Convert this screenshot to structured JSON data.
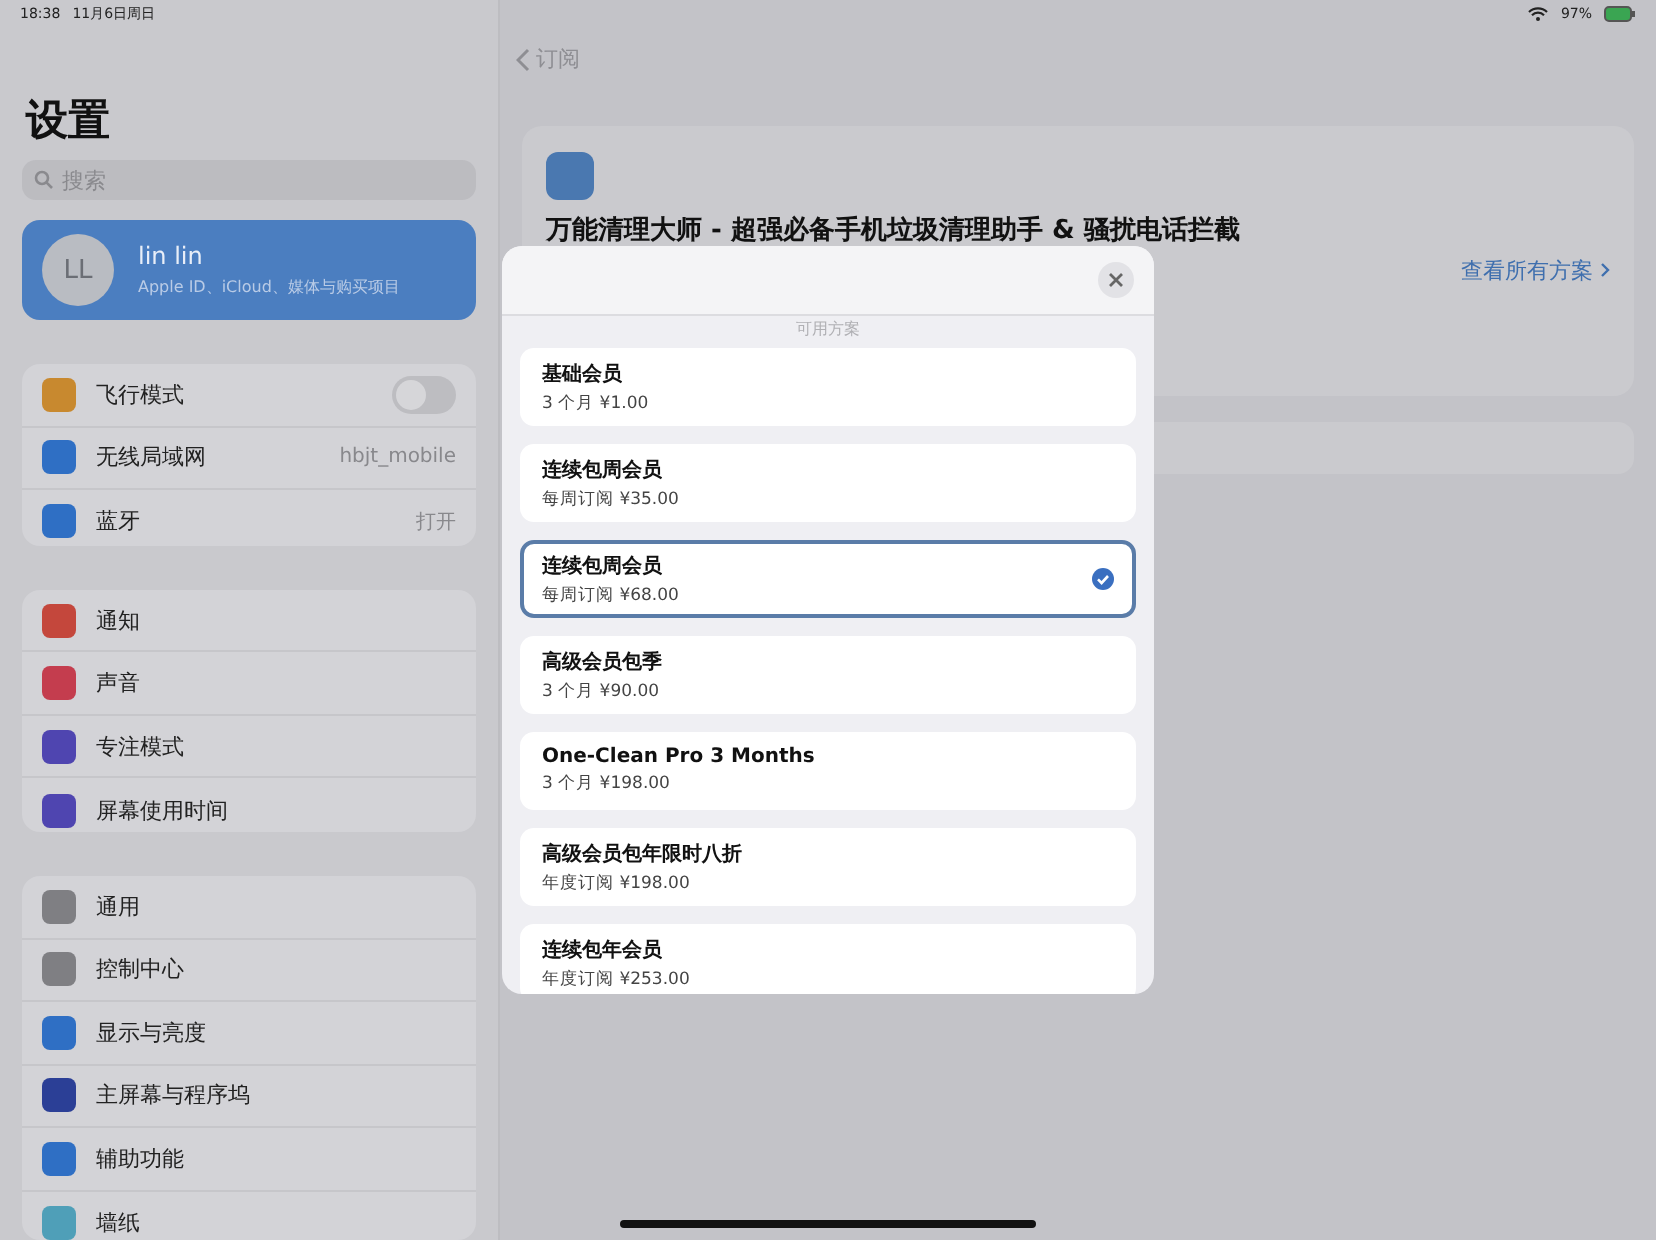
{
  "status_bar": {
    "time": "18:38",
    "date": "11月6日周日",
    "battery": "97%"
  },
  "sidebar": {
    "title": "设置",
    "search": {
      "placeholder": "搜索"
    },
    "profile": {
      "initials": "LL",
      "name": "lin lin",
      "subtitle": "Apple ID、iCloud、媒体与购买项目"
    },
    "groups": [
      [
        {
          "label": "飞行模式",
          "kind": "toggle",
          "on": false,
          "color": "#c8892f"
        },
        {
          "label": "无线局域网",
          "kind": "value",
          "value": "hbjt_mobile",
          "color": "#2f6fc4"
        },
        {
          "label": "蓝牙",
          "kind": "value",
          "value": "打开",
          "color": "#2f6fc4"
        }
      ],
      [
        {
          "label": "通知",
          "kind": "plain",
          "color": "#c4473c"
        },
        {
          "label": "声音",
          "kind": "plain",
          "color": "#c43d4e"
        },
        {
          "label": "专注模式",
          "kind": "plain",
          "color": "#4f45b0"
        },
        {
          "label": "屏幕使用时间",
          "kind": "plain",
          "color": "#4f45b0"
        }
      ],
      [
        {
          "label": "通用",
          "kind": "plain",
          "color": "#7f7f83"
        },
        {
          "label": "控制中心",
          "kind": "plain",
          "color": "#7f7f83"
        },
        {
          "label": "显示与亮度",
          "kind": "plain",
          "color": "#2f6fc4"
        },
        {
          "label": "主屏幕与程序坞",
          "kind": "plain",
          "color": "#2b3f96"
        },
        {
          "label": "辅助功能",
          "kind": "plain",
          "color": "#2f6fc4"
        },
        {
          "label": "墙纸",
          "kind": "plain",
          "color": "#4f9fb8"
        }
      ]
    ]
  },
  "detail": {
    "back": "订阅",
    "app_title": "万能清理大师 - 超强必备手机垃圾清理助手 & 骚扰电话拦截",
    "see_all": "查看所有方案"
  },
  "modal": {
    "subtitle": "可用方案",
    "plans": [
      {
        "name": "基础会员",
        "price": "3 个月 ¥1.00",
        "selected": false
      },
      {
        "name": "连续包周会员",
        "price": "每周订阅 ¥35.00",
        "selected": false
      },
      {
        "name": "连续包周会员",
        "price": "每周订阅 ¥68.00",
        "selected": true
      },
      {
        "name": "高级会员包季",
        "price": "3 个月 ¥90.00",
        "selected": false
      },
      {
        "name": "One-Clean Pro 3 Months",
        "price": "3 个月 ¥198.00",
        "selected": false
      },
      {
        "name": "高级会员包年限时八折",
        "price": "年度订阅 ¥198.00",
        "selected": false
      },
      {
        "name": "连续包年会员",
        "price": "年度订阅 ¥253.00",
        "selected": false
      }
    ]
  }
}
